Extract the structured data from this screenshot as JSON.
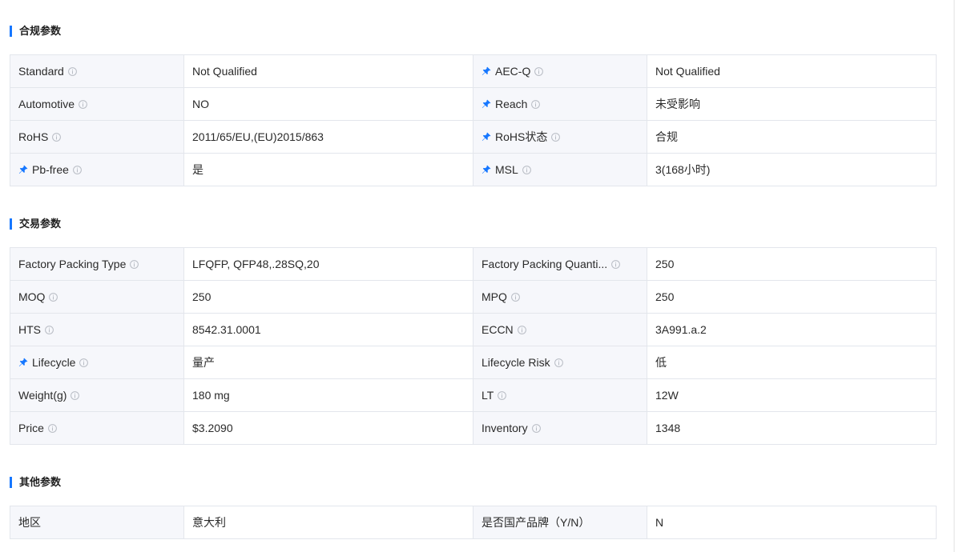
{
  "sections": [
    {
      "title": "合规参数",
      "rows": [
        [
          {
            "label": "Standard",
            "pinned": false,
            "info": true,
            "value": "Not Qualified"
          },
          {
            "label": "AEC-Q",
            "pinned": true,
            "info": true,
            "value": "Not Qualified"
          }
        ],
        [
          {
            "label": "Automotive",
            "pinned": false,
            "info": true,
            "value": "NO"
          },
          {
            "label": "Reach",
            "pinned": true,
            "info": true,
            "value": "未受影响"
          }
        ],
        [
          {
            "label": "RoHS",
            "pinned": false,
            "info": true,
            "value": "2011/65/EU,(EU)2015/863"
          },
          {
            "label": "RoHS状态",
            "pinned": true,
            "info": true,
            "value": "合规"
          }
        ],
        [
          {
            "label": "Pb-free",
            "pinned": true,
            "info": true,
            "value": "是"
          },
          {
            "label": "MSL",
            "pinned": true,
            "info": true,
            "value": "3(168小时)"
          }
        ]
      ]
    },
    {
      "title": "交易参数",
      "rows": [
        [
          {
            "label": "Factory Packing Type",
            "pinned": false,
            "info": true,
            "value": "LFQFP, QFP48,.28SQ,20"
          },
          {
            "label": "Factory Packing Quanti...",
            "pinned": false,
            "info": true,
            "value": "250"
          }
        ],
        [
          {
            "label": "MOQ",
            "pinned": false,
            "info": true,
            "value": "250"
          },
          {
            "label": "MPQ",
            "pinned": false,
            "info": true,
            "value": "250"
          }
        ],
        [
          {
            "label": "HTS",
            "pinned": false,
            "info": true,
            "value": "8542.31.0001"
          },
          {
            "label": "ECCN",
            "pinned": false,
            "info": true,
            "value": "3A991.a.2"
          }
        ],
        [
          {
            "label": "Lifecycle",
            "pinned": true,
            "info": true,
            "value": "量产"
          },
          {
            "label": "Lifecycle Risk",
            "pinned": false,
            "info": true,
            "value": "低"
          }
        ],
        [
          {
            "label": "Weight(g)",
            "pinned": false,
            "info": true,
            "value": "180 mg"
          },
          {
            "label": "LT",
            "pinned": false,
            "info": true,
            "value": "12W"
          }
        ],
        [
          {
            "label": "Price",
            "pinned": false,
            "info": true,
            "value": "$3.2090"
          },
          {
            "label": "Inventory",
            "pinned": false,
            "info": true,
            "value": "1348"
          }
        ]
      ]
    },
    {
      "title": "其他参数",
      "rows": [
        [
          {
            "label": "地区",
            "pinned": false,
            "info": false,
            "value": "意大利"
          },
          {
            "label": "是否国产品牌（Y/N）",
            "pinned": false,
            "info": false,
            "value": "N"
          }
        ]
      ]
    }
  ],
  "colors": {
    "accent": "#1677ff",
    "label_bg": "#f6f7fb",
    "border": "#e3e6ec",
    "info_icon": "#b8bcc4"
  },
  "icons": {
    "pin": "pin-icon",
    "info": "info-circle-icon"
  }
}
